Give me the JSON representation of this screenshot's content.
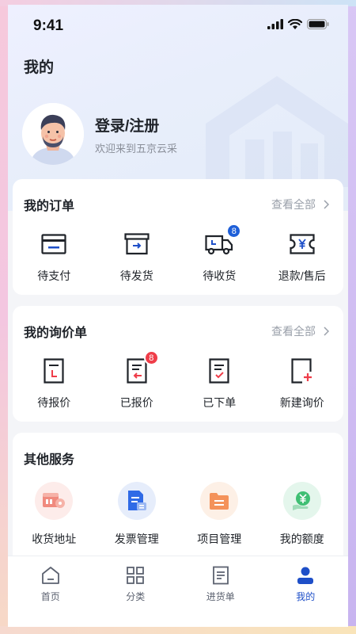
{
  "status": {
    "time": "9:41"
  },
  "page": {
    "title": "我的"
  },
  "profile": {
    "login_label": "登录/注册",
    "welcome": "欢迎来到五京云采"
  },
  "orders": {
    "title": "我的订单",
    "view_all": "查看全部",
    "items": [
      {
        "label": "待支付",
        "icon": "card-icon"
      },
      {
        "label": "待发货",
        "icon": "box-icon"
      },
      {
        "label": "待收货",
        "icon": "truck-icon",
        "badge": "8"
      },
      {
        "label": "退款/售后",
        "icon": "refund-icon"
      }
    ]
  },
  "inquiries": {
    "title": "我的询价单",
    "view_all": "查看全部",
    "items": [
      {
        "label": "待报价",
        "icon": "pending-quote-icon"
      },
      {
        "label": "已报价",
        "icon": "quoted-icon",
        "badge": "8"
      },
      {
        "label": "已下单",
        "icon": "ordered-icon"
      },
      {
        "label": "新建询价",
        "icon": "new-inquiry-icon"
      }
    ]
  },
  "services": {
    "title": "其他服务",
    "items": [
      {
        "label": "收货地址",
        "icon": "address-icon"
      },
      {
        "label": "发票管理",
        "icon": "invoice-icon"
      },
      {
        "label": "项目管理",
        "icon": "project-icon"
      },
      {
        "label": "我的额度",
        "icon": "credit-icon"
      }
    ]
  },
  "tabbar": {
    "items": [
      {
        "label": "首页",
        "icon": "home-icon"
      },
      {
        "label": "分类",
        "icon": "category-icon"
      },
      {
        "label": "进货单",
        "icon": "purchase-list-icon"
      },
      {
        "label": "我的",
        "icon": "user-icon",
        "active": true
      }
    ]
  },
  "colors": {
    "primary": "#1e4fc8",
    "accent_red": "#ef3d49",
    "text": "#1f2329",
    "muted": "#9aa0aa"
  }
}
